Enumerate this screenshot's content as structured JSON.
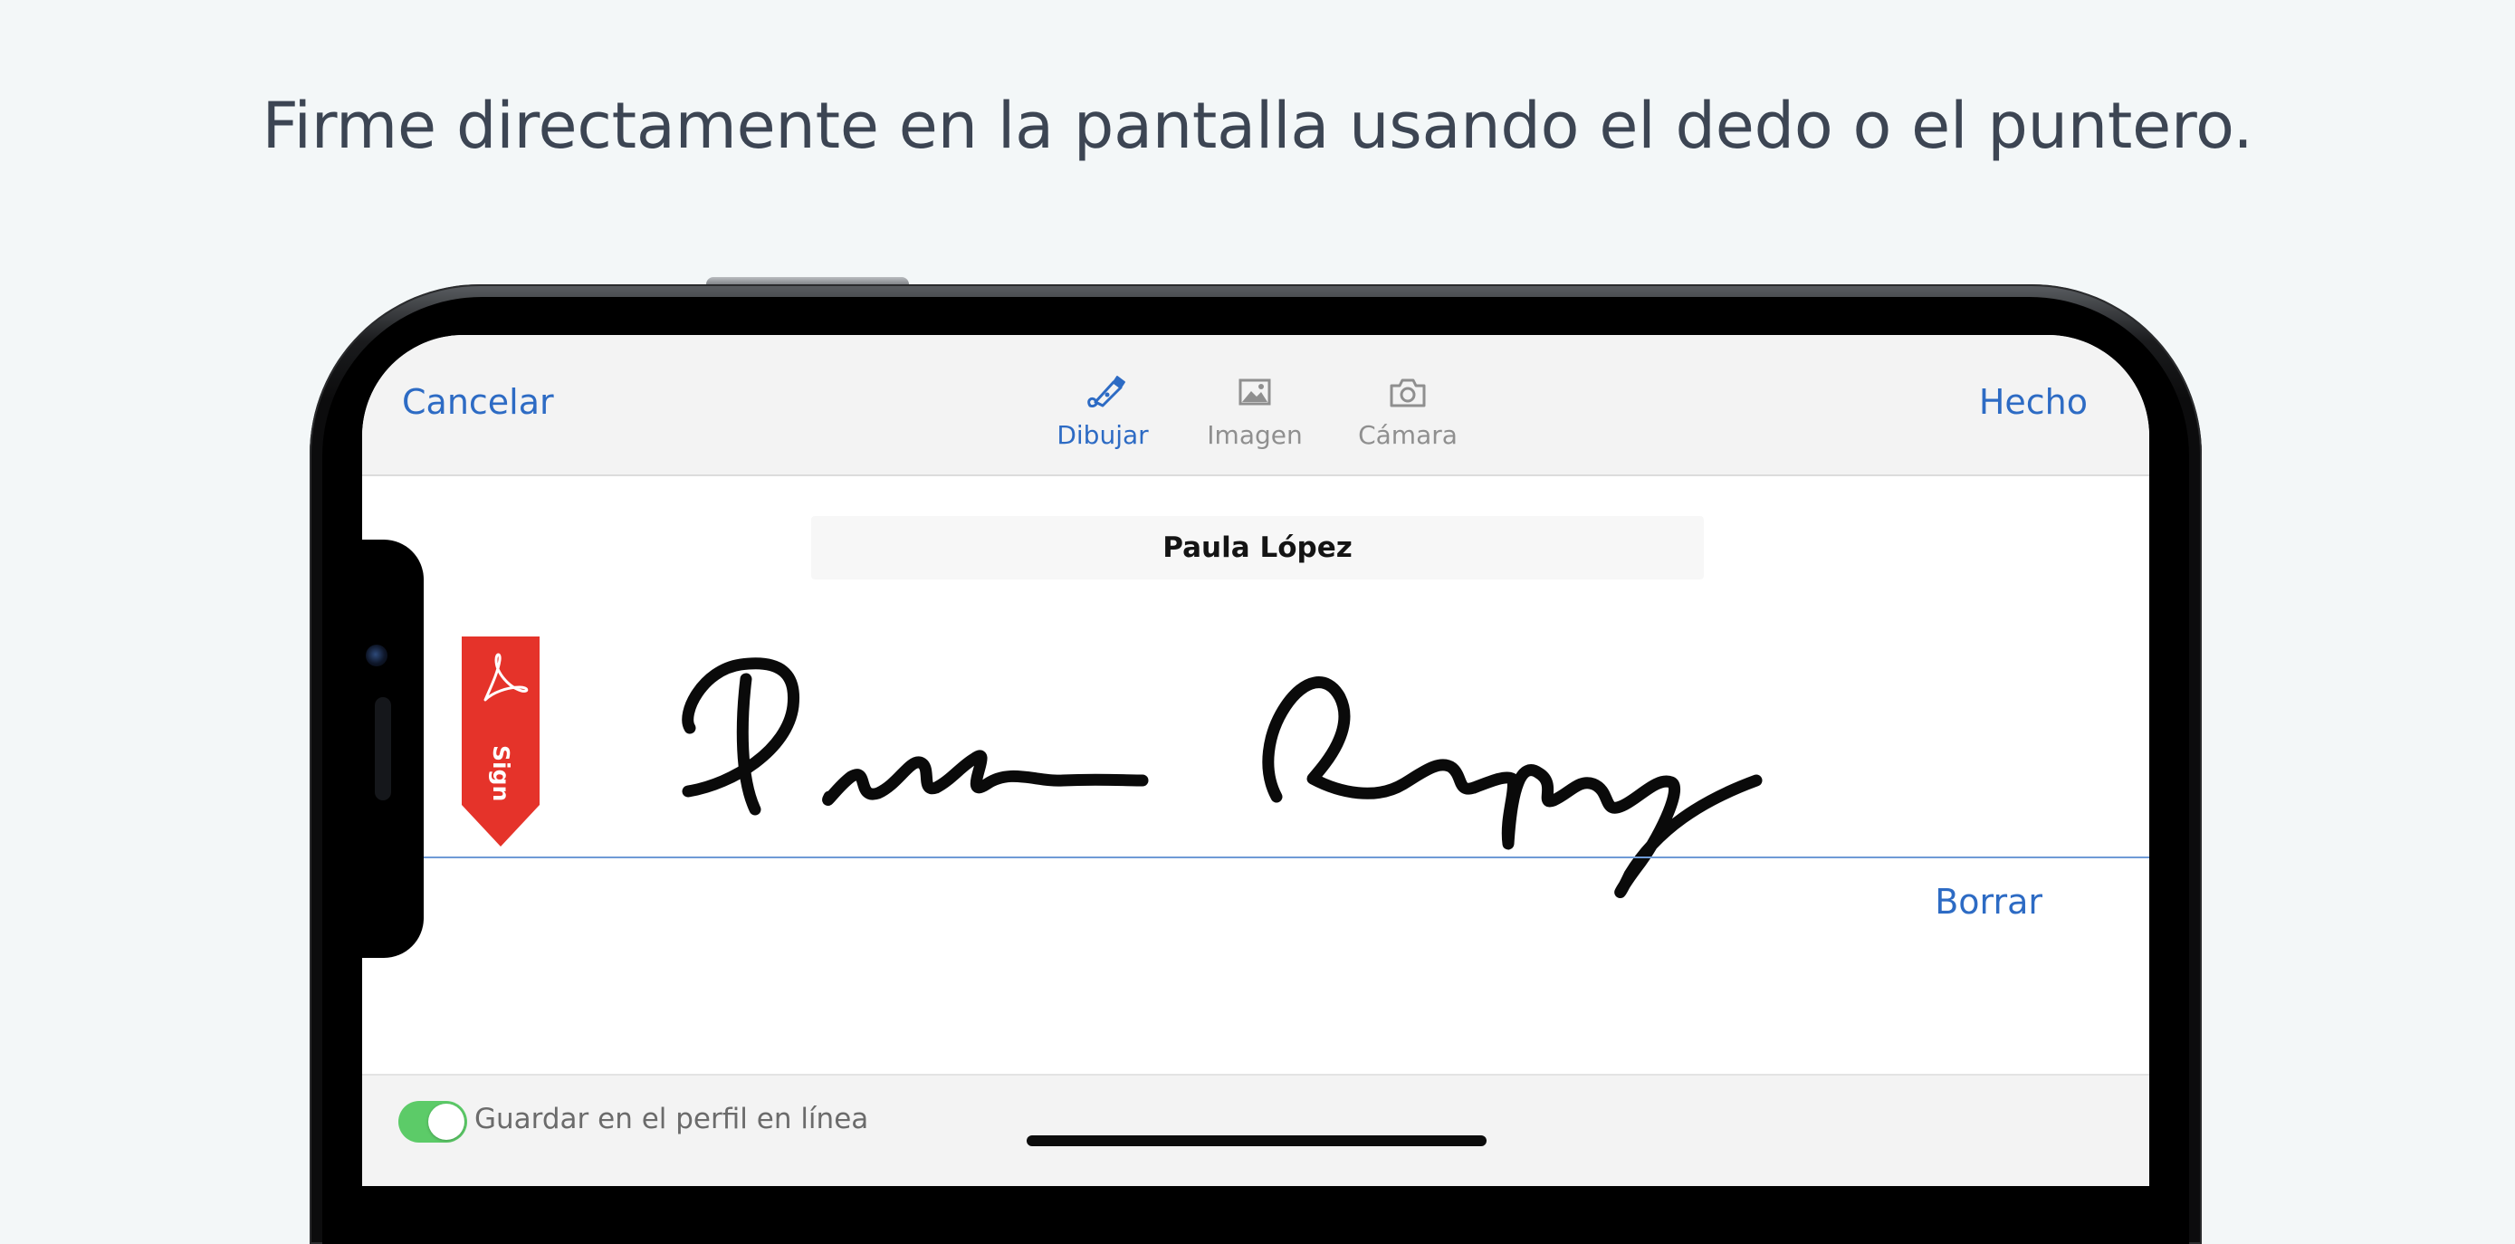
{
  "headline": "Firme directamente en la pantalla usando el dedo o el puntero.",
  "nav": {
    "cancel_label": "Cancelar",
    "done_label": "Hecho"
  },
  "tabs": [
    {
      "label": "Dibujar",
      "icon": "pen-icon",
      "active": true
    },
    {
      "label": "Imagen",
      "icon": "image-icon",
      "active": false
    },
    {
      "label": "Cámara",
      "icon": "camera-icon",
      "active": false
    }
  ],
  "signer_name": "Paula López",
  "sign_ribbon": {
    "label": "Sign",
    "icon": "acrobat-logo-icon",
    "color": "#e5332a"
  },
  "signature": {
    "strokes_description_icon": "handwritten-signature"
  },
  "erase_label": "Borrar",
  "save_profile": {
    "label": "Guardar en el perfil en línea",
    "enabled": true
  },
  "colors": {
    "accent": "#2d6bc4",
    "toggle_on": "#5ccb68",
    "headline": "#3c4553"
  }
}
